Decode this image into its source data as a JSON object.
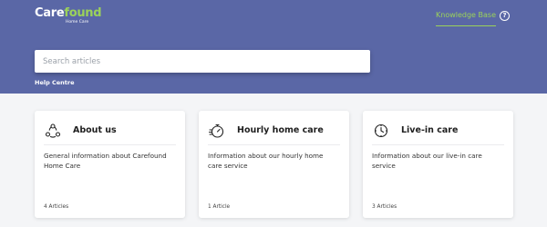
{
  "brand": {
    "name_part1": "Care",
    "name_part2": "found",
    "tagline": "Home Care",
    "accent": "#9bd25a"
  },
  "header": {
    "nav_link": "Knowledge Base",
    "help_icon": "help-circle-icon",
    "background": "#5a67a6"
  },
  "search": {
    "placeholder": "Search articles"
  },
  "breadcrumb": {
    "label": "Help Centre"
  },
  "categories": [
    {
      "title": "About us",
      "description": "General information about Carefound Home Care",
      "count": "4 Articles",
      "icon": "people-cycle-icon"
    },
    {
      "title": "Hourly home care",
      "description": "Information about our hourly home care service",
      "count": "1 Article",
      "icon": "stopwatch-icon"
    },
    {
      "title": "Live-in care",
      "description": "Information about our live-in care service",
      "count": "3 Articles",
      "icon": "clock-icon"
    }
  ]
}
